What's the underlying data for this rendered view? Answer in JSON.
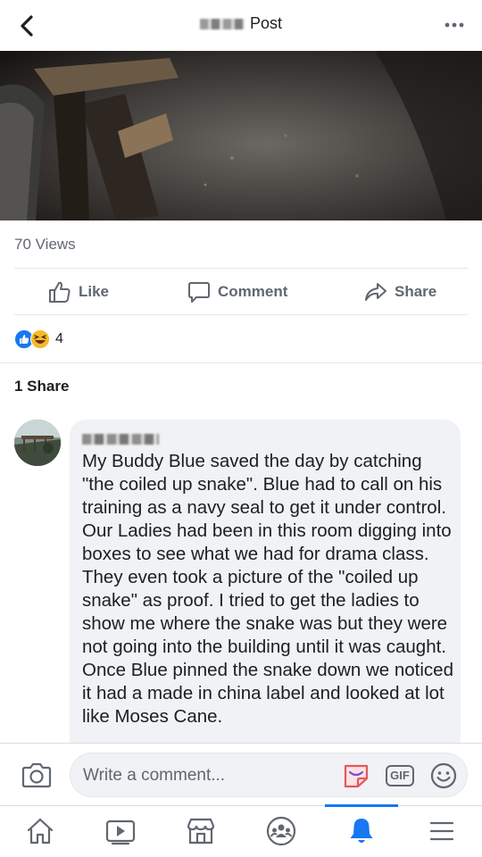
{
  "header": {
    "title": "Post",
    "back_icon": "chevron-left-icon",
    "more_icon": "more-dots-icon"
  },
  "post": {
    "views": "70 Views",
    "actions": {
      "like": "Like",
      "comment": "Comment",
      "share": "Share"
    },
    "reaction_count": "4",
    "shares": "1 Share"
  },
  "comment": {
    "text": "My Buddy Blue saved the day by catching \"the coiled up snake\". Blue had to call on his training as a navy seal to get it under control. Our Ladies had been in this room digging into boxes to see what we had for drama class. They even took a picture of the \"coiled up snake\" as proof. I tried to get the ladies to show me where the snake was but they were not going into the building until it was caught. Once Blue pinned the snake down we noticed it had a made in china label and looked at lot like Moses Cane."
  },
  "composer": {
    "placeholder": "Write a comment...",
    "gif_label": "GIF"
  },
  "colors": {
    "accent": "#1877f2",
    "text_secondary": "#606770",
    "bubble_bg": "#f0f2f5",
    "sticker": "#e4585b"
  },
  "nav": {
    "items": [
      "home-icon",
      "watch-icon",
      "marketplace-icon",
      "groups-icon",
      "notifications-icon",
      "menu-icon"
    ],
    "active": "notifications-icon"
  }
}
